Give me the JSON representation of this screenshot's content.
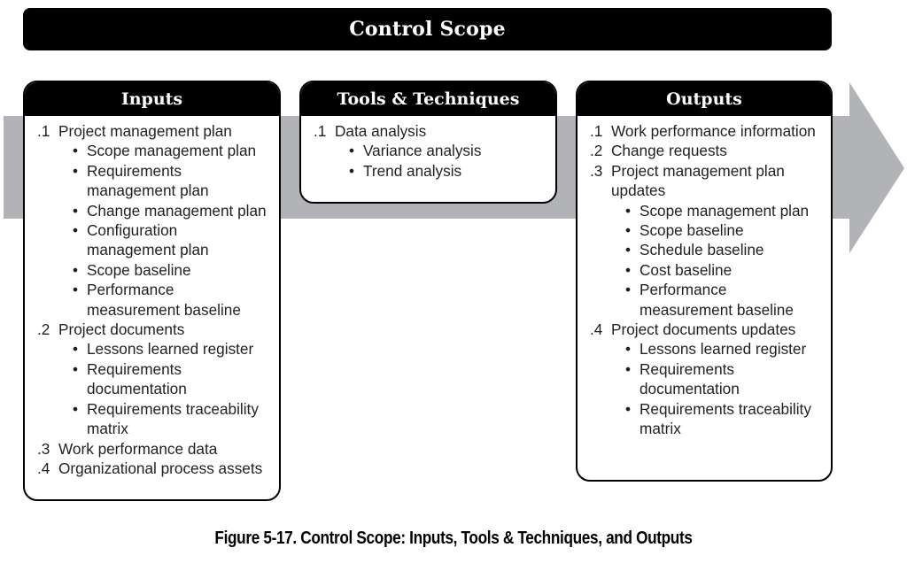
{
  "title": "Control Scope",
  "colors": {
    "arrow": "#b1b3b6",
    "header_bg": "#000000",
    "text": "#231f20"
  },
  "columns": {
    "inputs": {
      "header": "Inputs",
      "items": [
        {
          "num": ".1",
          "text": "Project management plan",
          "subs": [
            "Scope management plan",
            "Requirements management plan",
            "Change management plan",
            "Configuration management plan",
            "Scope baseline",
            "Performance measurement baseline"
          ]
        },
        {
          "num": ".2",
          "text": "Project documents",
          "subs": [
            "Lessons learned register",
            "Requirements documentation",
            "Requirements traceability matrix"
          ]
        },
        {
          "num": ".3",
          "text": "Work performance data",
          "subs": []
        },
        {
          "num": ".4",
          "text": "Organizational process assets",
          "subs": []
        }
      ]
    },
    "tools": {
      "header": "Tools & Techniques",
      "items": [
        {
          "num": ".1",
          "text": "Data analysis",
          "subs": [
            "Variance analysis",
            "Trend analysis"
          ]
        }
      ]
    },
    "outputs": {
      "header": "Outputs",
      "items": [
        {
          "num": ".1",
          "text": "Work performance information",
          "subs": []
        },
        {
          "num": ".2",
          "text": "Change requests",
          "subs": []
        },
        {
          "num": ".3",
          "text": "Project management plan updates",
          "subs": [
            "Scope management plan",
            "Scope baseline",
            "Schedule baseline",
            "Cost baseline",
            "Performance measurement baseline"
          ]
        },
        {
          "num": ".4",
          "text": "Project documents updates",
          "subs": [
            "Lessons learned register",
            "Requirements documentation",
            "Requirements traceability matrix"
          ]
        }
      ]
    }
  },
  "caption": "Figure 5-17. Control Scope: Inputs, Tools & Techniques, and Outputs"
}
